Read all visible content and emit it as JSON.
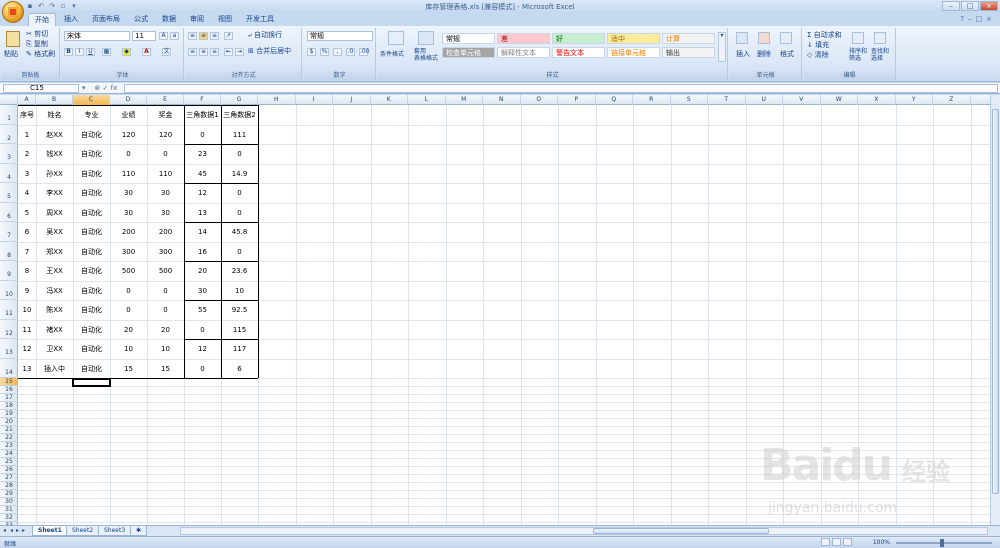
{
  "window": {
    "title": "库存管理表格.xls [兼容模式] - Microsoft Excel"
  },
  "qat": [
    "save",
    "undo",
    "redo",
    "preview"
  ],
  "tabs": [
    "开始",
    "插入",
    "页面布局",
    "公式",
    "数据",
    "审阅",
    "视图",
    "开发工具"
  ],
  "clipboard": {
    "paste": "粘贴",
    "cut": "剪切",
    "copy": "复制",
    "format_painter": "格式刷",
    "label": "剪贴板"
  },
  "font": {
    "name": "宋体",
    "size": "11",
    "label": "字体"
  },
  "alignment": {
    "wrap": "自动换行",
    "merge": "合并后居中",
    "label": "对齐方式"
  },
  "number": {
    "format": "常规",
    "label": "数字"
  },
  "styles": {
    "cond_format": "条件格式",
    "table_format": "套用\n表格格式",
    "label": "样式",
    "cells": [
      {
        "text": "常规",
        "bg": "#ffffff",
        "fg": "#000000"
      },
      {
        "text": "差",
        "bg": "#ffc7ce",
        "fg": "#9c0006"
      },
      {
        "text": "好",
        "bg": "#c6efce",
        "fg": "#006100"
      },
      {
        "text": "适中",
        "bg": "#ffeb9c",
        "fg": "#9c6500"
      },
      {
        "text": "计算",
        "bg": "#f2f2f2",
        "fg": "#fa7d00"
      },
      {
        "text": "检查单元格",
        "bg": "#a5a5a5",
        "fg": "#ffffff"
      },
      {
        "text": "解释性文本",
        "bg": "#ffffff",
        "fg": "#7f7f7f"
      },
      {
        "text": "警告文本",
        "bg": "#ffffff",
        "fg": "#ff0000"
      },
      {
        "text": "链接单元格",
        "bg": "#ffffff",
        "fg": "#fa7d00"
      },
      {
        "text": "输出",
        "bg": "#f2f2f2",
        "fg": "#3f3f3f"
      }
    ]
  },
  "cellsgroup": {
    "insert": "插入",
    "delete": "删除",
    "format": "格式",
    "label": "单元格"
  },
  "editing": {
    "autosum": "自动求和",
    "fill": "填充",
    "clear": "清除",
    "sort": "排序和\n筛选",
    "find": "查找和\n选择",
    "label": "编辑"
  },
  "formula_bar": {
    "name_box": "C15",
    "fx": "fx",
    "formula": ""
  },
  "columns": [
    "A",
    "B",
    "C",
    "D",
    "E",
    "F",
    "G",
    "H",
    "I",
    "J",
    "K",
    "L",
    "M",
    "N",
    "O",
    "P",
    "Q",
    "R",
    "S",
    "T",
    "U",
    "V",
    "W",
    "X",
    "Y",
    "Z"
  ],
  "table": {
    "headers": [
      "序号",
      "姓名",
      "专业",
      "业绩",
      "奖金",
      "三角数据1",
      "三角数据2"
    ],
    "rows": [
      [
        "1",
        "赵XX",
        "自动化",
        "120",
        "120",
        "0",
        "111"
      ],
      [
        "2",
        "钱XX",
        "自动化",
        "0",
        "0",
        "23",
        "0"
      ],
      [
        "3",
        "孙XX",
        "自动化",
        "110",
        "110",
        "45",
        "14.9"
      ],
      [
        "4",
        "李XX",
        "自动化",
        "30",
        "30",
        "12",
        "0"
      ],
      [
        "5",
        "周XX",
        "自动化",
        "30",
        "30",
        "13",
        "0"
      ],
      [
        "6",
        "吴XX",
        "自动化",
        "200",
        "200",
        "14",
        "45.8"
      ],
      [
        "7",
        "郑XX",
        "自动化",
        "300",
        "300",
        "16",
        "0"
      ],
      [
        "8",
        "王XX",
        "自动化",
        "500",
        "500",
        "20",
        "23.6"
      ],
      [
        "9",
        "冯XX",
        "自动化",
        "0",
        "0",
        "30",
        "10"
      ],
      [
        "10",
        "陈XX",
        "自动化",
        "0",
        "0",
        "55",
        "92.5"
      ],
      [
        "11",
        "褚XX",
        "自动化",
        "20",
        "20",
        "0",
        "115"
      ],
      [
        "12",
        "卫XX",
        "自动化",
        "10",
        "10",
        "12",
        "117"
      ],
      [
        "13",
        "插入中",
        "自动化",
        "15",
        "15",
        "0",
        "6"
      ]
    ]
  },
  "row_numbers": [
    "1",
    "2",
    "3",
    "4",
    "5",
    "6",
    "7",
    "8",
    "9",
    "10",
    "11",
    "12",
    "13",
    "14",
    "15",
    "16",
    "17",
    "18",
    "19",
    "20",
    "21",
    "22",
    "23",
    "24",
    "25",
    "26",
    "27",
    "28",
    "29",
    "30",
    "31",
    "32",
    "33",
    "34",
    "35"
  ],
  "sheet_tabs": [
    "Sheet1",
    "Sheet2",
    "Sheet3"
  ],
  "status": {
    "ready": "就绪",
    "zoom": "100%"
  },
  "watermark": {
    "main": "Baidu",
    "cn": "经验",
    "url": "jingyan.baidu.com"
  }
}
